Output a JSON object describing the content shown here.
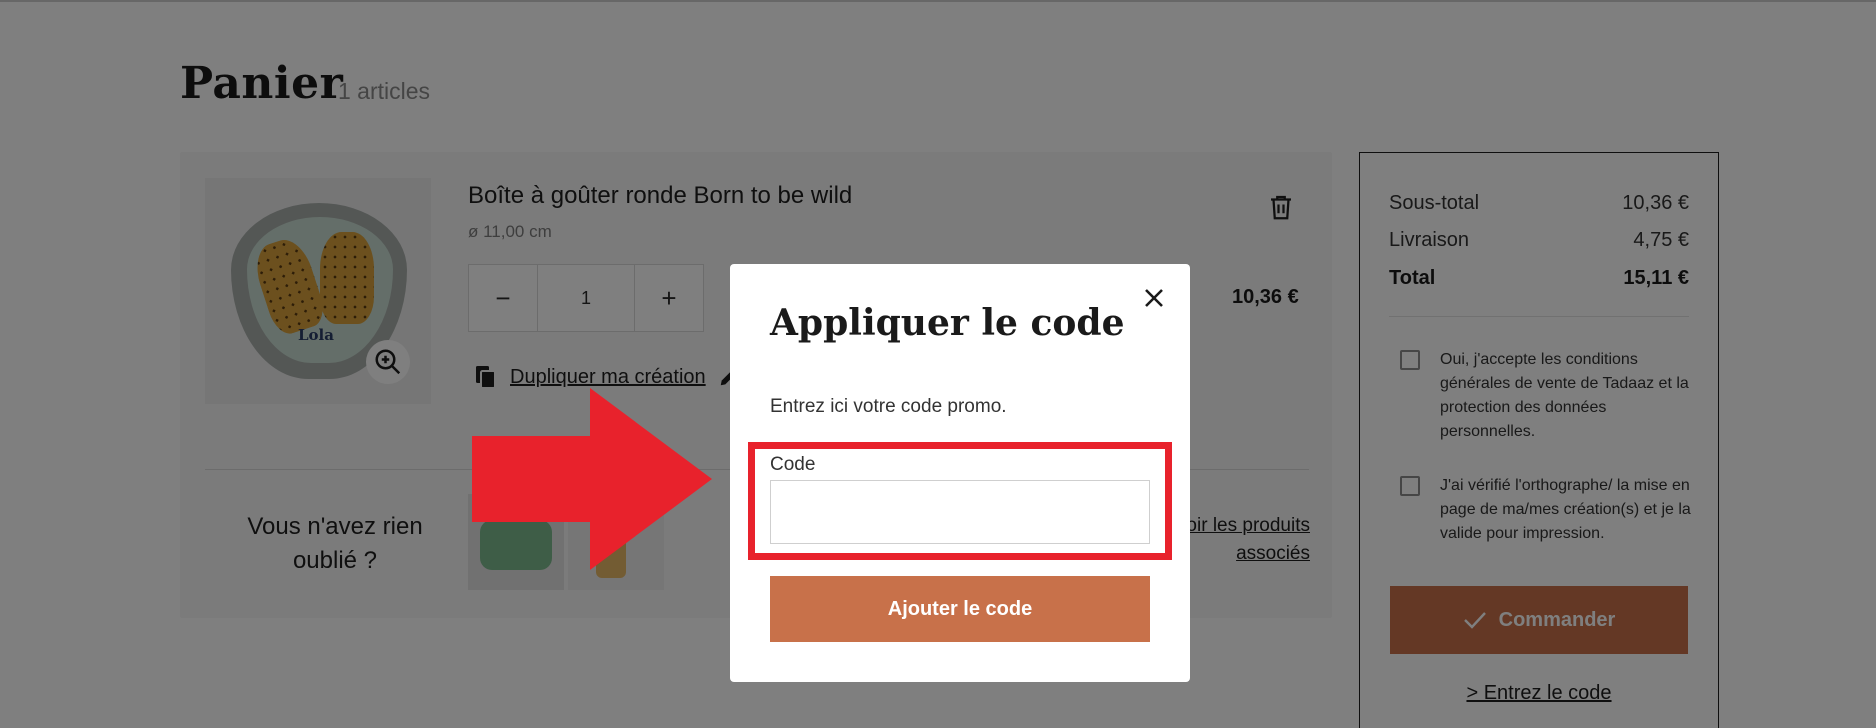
{
  "cart": {
    "title": "Panier",
    "count": "1 articles"
  },
  "product": {
    "name": "Boîte à goûter ronde Born to be wild",
    "size": "ø 11,00 cm",
    "personalization": "Lola",
    "quantity": "1",
    "minus": "−",
    "plus": "+",
    "price": "10,36 €",
    "duplicate_label": "Dupliquer ma création"
  },
  "related": {
    "prompt": "Vous n'avez rien oublié ?",
    "see_all_line1": "Voir les produits",
    "see_all_line2": "associés"
  },
  "summary": {
    "subtotal_label": "Sous-total",
    "subtotal_value": "10,36 €",
    "shipping_label": "Livraison",
    "shipping_value": "4,75 €",
    "total_label": "Total",
    "total_value": "15,11 €",
    "terms_text": "Oui, j'accepte les conditions générales de vente de Tadaaz et la protection des données personnelles.",
    "spelling_text": "J'ai vérifié l'orthographe/ la mise en page de ma/mes création(s) et je la valide pour impression.",
    "order_label": "Commander",
    "code_link": "> Entrez le code"
  },
  "modal": {
    "title": "Appliquer le code",
    "description": "Entrez ici votre code promo.",
    "code_label": "Code",
    "code_value": "",
    "submit_label": "Ajouter le code"
  },
  "colors": {
    "accent": "#c8714a",
    "annotation": "#e8222c"
  }
}
